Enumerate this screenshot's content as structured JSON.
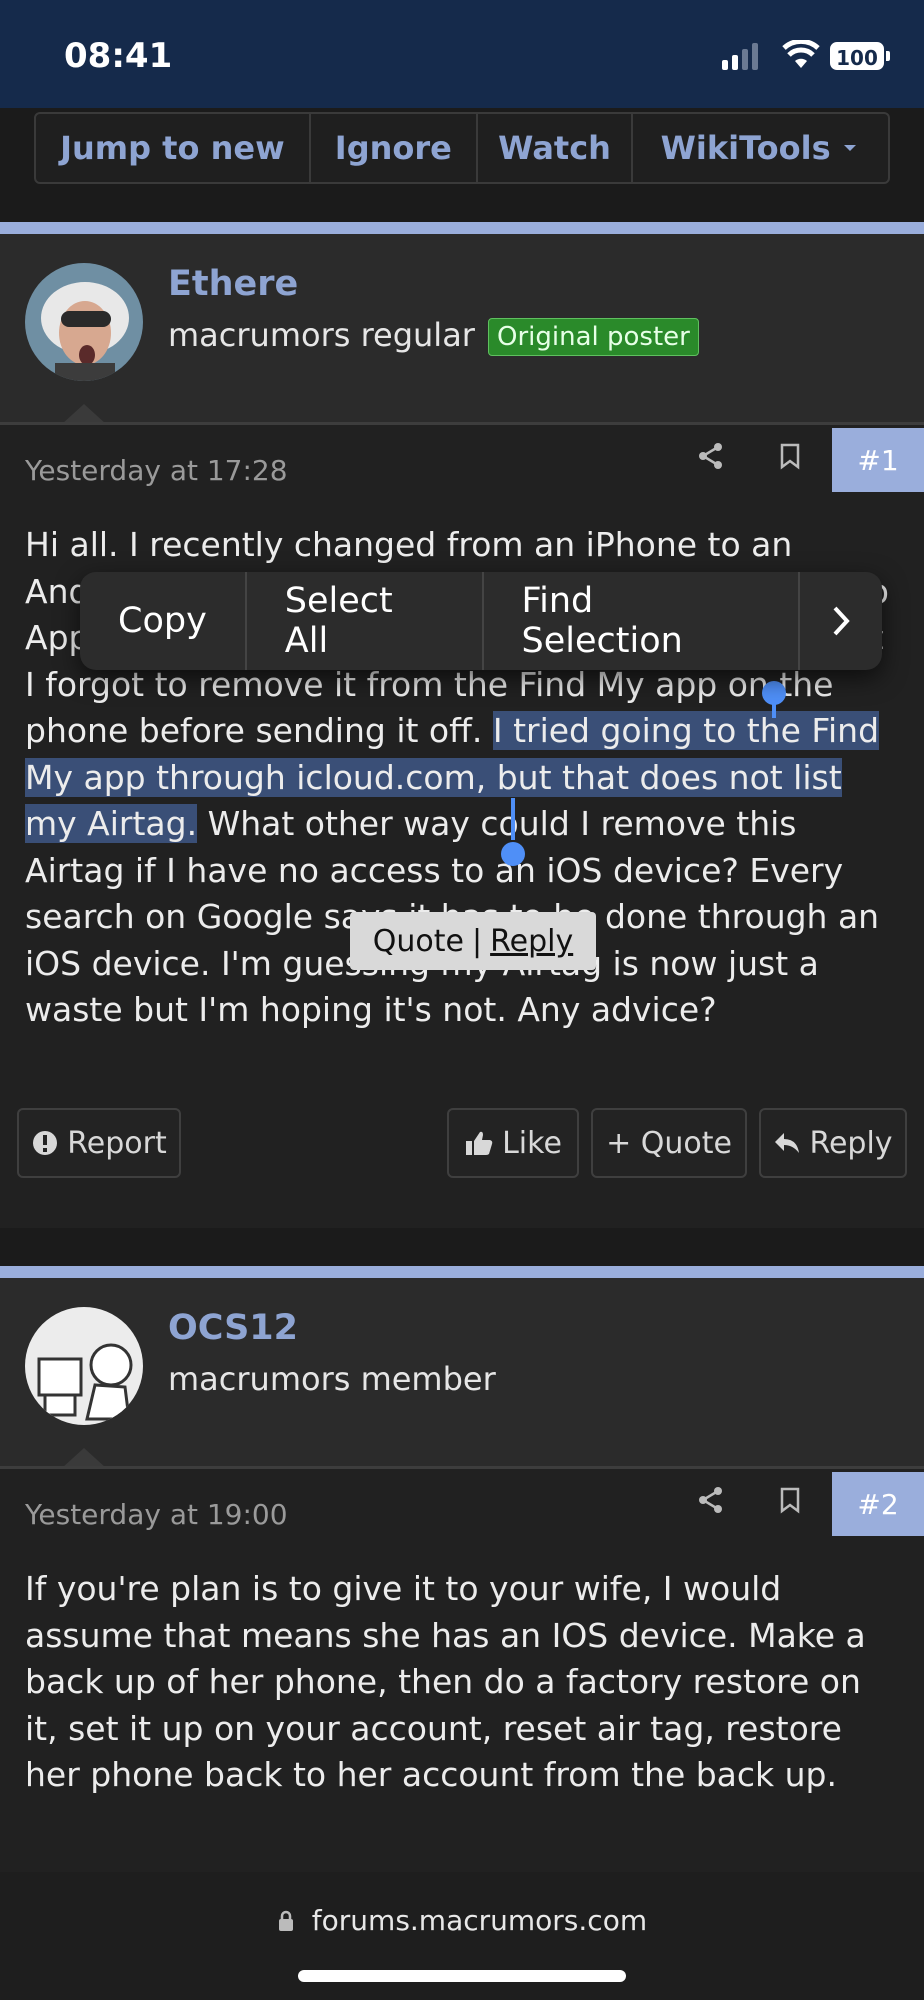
{
  "status": {
    "time": "08:41",
    "battery": "100"
  },
  "thread_actions": [
    "Jump to new",
    "Ignore",
    "Watch",
    "WikiTools"
  ],
  "posts": [
    {
      "username": "Ethere",
      "user_title": "macrumors regular",
      "badge": "Original poster",
      "date": "Yesterday at 17:28",
      "number": "#1",
      "message": {
        "part1": "Hi all. I recently changed from an iPhone to an Android phone and I'm giving my old iPhone back to Apple. I was going to give my Airtag to my wife, but I forgot to remove it from the Find My app on the phone before sending it off. ",
        "selected": "I tried going to the Find My app through icloud.com, but that does not list my Airtag.",
        "part2": " What other way could I remove this Airtag if I have no access to an iOS device? Every search on Google says it has to be done through an iOS device. I'm guessing my Airtag is now just a waste but I'm hoping it's not. Any advice?"
      },
      "buttons": {
        "report": "Report",
        "like": "Like",
        "quote": "+ Quote",
        "reply": "Reply"
      }
    },
    {
      "username": "OCS12",
      "user_title": "macrumors member",
      "date": "Yesterday at 19:00",
      "number": "#2",
      "message": "If you're plan is to give it to your wife, I would assume that means she has an IOS device. Make a back up of her phone, then do a factory restore on it, set it up on your account, reset air tag, restore her phone back to her account from the back up."
    }
  ],
  "context_menu": [
    "Copy",
    "Select All",
    "Find Selection"
  ],
  "quote_reply": {
    "quote": "Quote",
    "sep": "|",
    "reply": "Reply"
  },
  "url": "forums.macrumors.com"
}
